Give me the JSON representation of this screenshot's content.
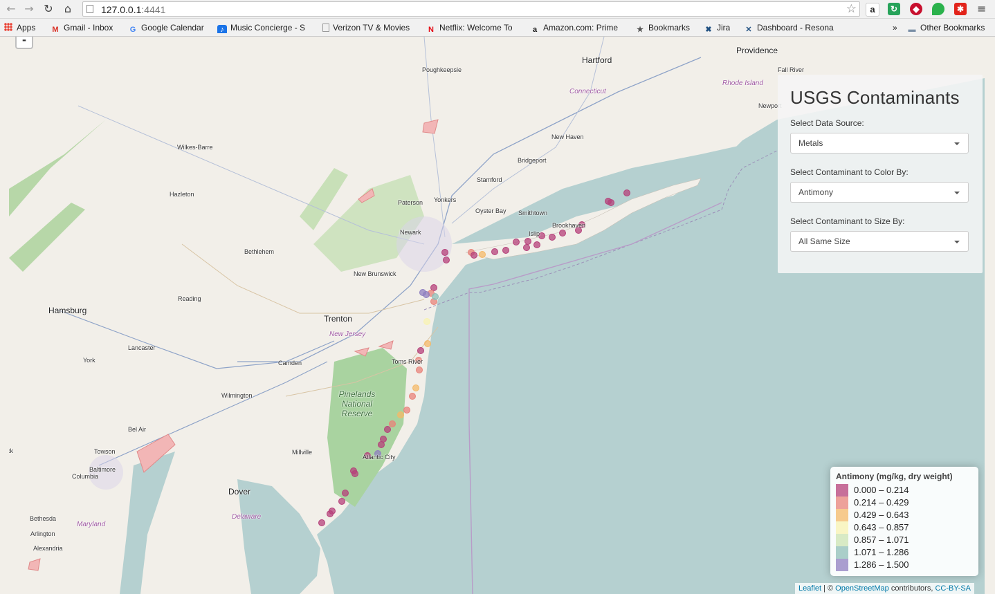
{
  "browser": {
    "url_host": "127.0.0.1",
    "url_port": ":4441",
    "bookmarks": [
      {
        "label": "Apps",
        "icon": "apps-grid-icon"
      },
      {
        "label": "Gmail - Inbox",
        "icon": "gmail-icon"
      },
      {
        "label": "Google Calendar",
        "icon": "google-icon"
      },
      {
        "label": "Music Concierge - S",
        "icon": "music-concierge-icon"
      },
      {
        "label": "Verizon TV & Movies",
        "icon": "page-icon"
      },
      {
        "label": "Netflix: Welcome To",
        "icon": "netflix-icon"
      },
      {
        "label": "Amazon.com: Prime",
        "icon": "amazon-icon"
      },
      {
        "label": "Bookmarks",
        "icon": "star-icon"
      },
      {
        "label": "Jira",
        "icon": "jira-icon"
      },
      {
        "label": "Dashboard - Resona",
        "icon": "dashboard-icon"
      },
      {
        "label": "»",
        "icon": "overflow-icon"
      },
      {
        "label": "Other Bookmarks",
        "icon": "folder-icon"
      }
    ]
  },
  "map": {
    "zoom_out_label": "-",
    "places": [
      {
        "name": "Providence",
        "kind": "big"
      },
      {
        "name": "Hartford",
        "kind": "big"
      },
      {
        "name": "Fall River",
        "kind": "small"
      },
      {
        "name": "Poughkeepsie",
        "kind": "small"
      },
      {
        "name": "Connecticut",
        "kind": "state"
      },
      {
        "name": "Rhode Island",
        "kind": "state"
      },
      {
        "name": "Newport",
        "kind": "small"
      },
      {
        "name": "Wilkes-Barre",
        "kind": "small"
      },
      {
        "name": "New Haven",
        "kind": "small"
      },
      {
        "name": "Bridgeport",
        "kind": "small"
      },
      {
        "name": "Stamford",
        "kind": "small"
      },
      {
        "name": "Hazleton",
        "kind": "small"
      },
      {
        "name": "Paterson",
        "kind": "small"
      },
      {
        "name": "Yonkers",
        "kind": "small"
      },
      {
        "name": "Oyster Bay",
        "kind": "small"
      },
      {
        "name": "Smithtown",
        "kind": "small"
      },
      {
        "name": "Brookhaven",
        "kind": "small"
      },
      {
        "name": "Newark",
        "kind": "small"
      },
      {
        "name": "Islip",
        "kind": "small"
      },
      {
        "name": "Bethlehem",
        "kind": "small"
      },
      {
        "name": "New Brunswick",
        "kind": "small"
      },
      {
        "name": "Reading",
        "kind": "small"
      },
      {
        "name": "Hamsburg",
        "kind": "big"
      },
      {
        "name": "Trenton",
        "kind": "big"
      },
      {
        "name": "New Jersey",
        "kind": "state"
      },
      {
        "name": "Lancaster",
        "kind": "small"
      },
      {
        "name": "York",
        "kind": "small"
      },
      {
        "name": "Camden",
        "kind": "small"
      },
      {
        "name": "Toms River",
        "kind": "small"
      },
      {
        "name": "Wilmington",
        "kind": "small"
      },
      {
        "name": "Pinelands National Reserve",
        "kind": "park"
      },
      {
        "name": "Bel Air",
        "kind": "small"
      },
      {
        "name": "Towson",
        "kind": "small"
      },
      {
        "name": "Millville",
        "kind": "small"
      },
      {
        "name": "Atlantic City",
        "kind": "small"
      },
      {
        "name": "Baltimore",
        "kind": "small"
      },
      {
        "name": "Columbia",
        "kind": "small"
      },
      {
        "name": "Dover",
        "kind": "big"
      },
      {
        "name": "Bethesda",
        "kind": "small"
      },
      {
        "name": "Maryland",
        "kind": "state"
      },
      {
        "name": "Delaware",
        "kind": "state"
      },
      {
        "name": "Arlington",
        "kind": "small"
      },
      {
        "name": "Alexandria",
        "kind": "small"
      },
      {
        "name": "ck",
        "kind": "small"
      }
    ]
  },
  "panel": {
    "title": "USGS Contaminants",
    "data_source_label": "Select Data Source:",
    "data_source_value": "Metals",
    "color_by_label": "Select Contaminant to Color By:",
    "color_by_value": "Antimony",
    "size_by_label": "Select Contaminant to Size By:",
    "size_by_value": "All Same Size"
  },
  "legend": {
    "title": "Antimony (mg/kg, dry weight)",
    "bins": [
      {
        "range": "0.000 – 0.214",
        "color": "#b5407a"
      },
      {
        "range": "0.214 – 0.429",
        "color": "#e8837a"
      },
      {
        "range": "0.429 – 0.643",
        "color": "#f4b968"
      },
      {
        "range": "0.643 – 0.857",
        "color": "#f8f3b2"
      },
      {
        "range": "0.857 – 1.071",
        "color": "#cce4b3"
      },
      {
        "range": "1.071 – 1.286",
        "color": "#8fbfb8"
      },
      {
        "range": "1.286 – 1.500",
        "color": "#8f7fc0"
      }
    ]
  },
  "attribution": {
    "leaflet": "Leaflet",
    "sep": " | © ",
    "osm": "OpenStreetMap",
    "contrib": " contributors, ",
    "license": "CC-BY-SA"
  }
}
